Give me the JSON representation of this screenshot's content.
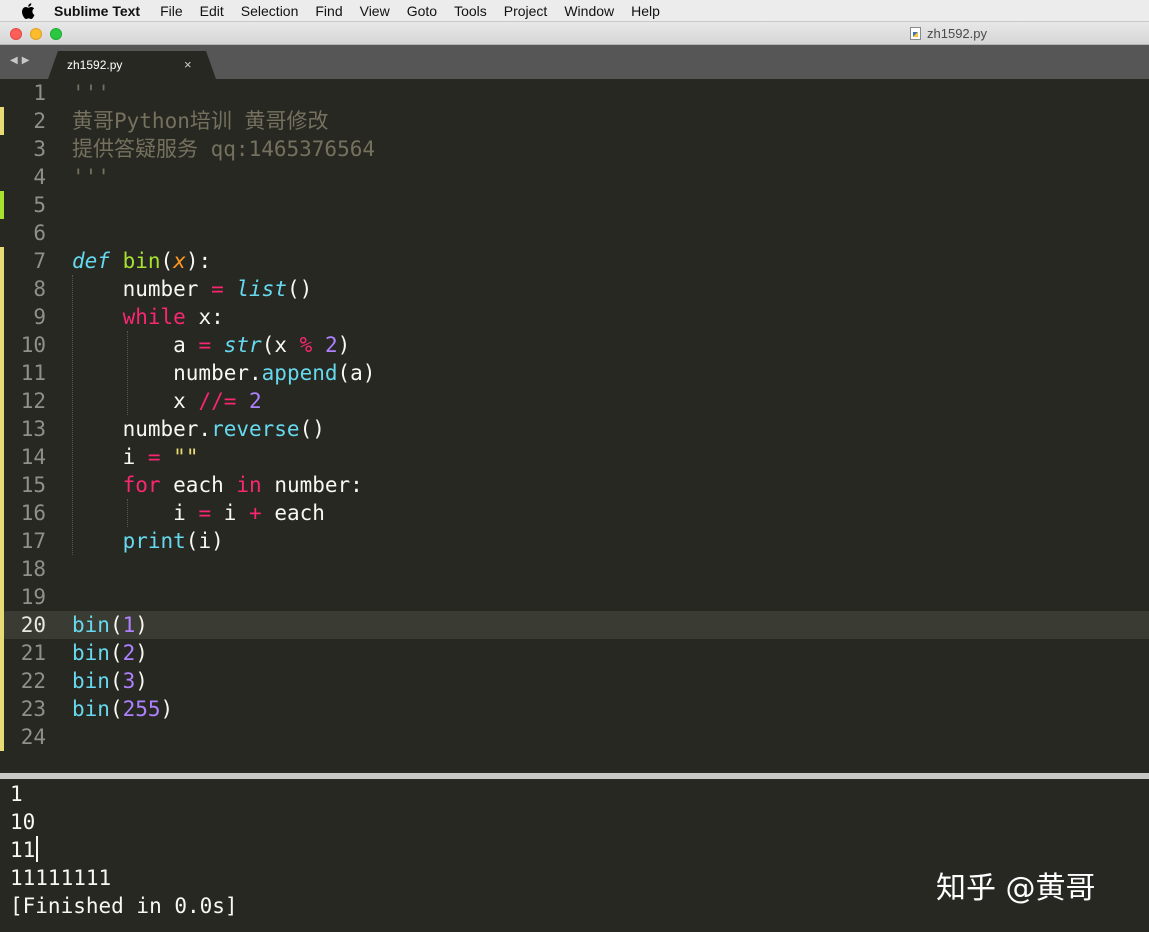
{
  "menubar": {
    "apple_icon": "apple-logo-icon",
    "app_name": "Sublime Text",
    "items": [
      "File",
      "Edit",
      "Selection",
      "Find",
      "View",
      "Goto",
      "Tools",
      "Project",
      "Window",
      "Help"
    ]
  },
  "window": {
    "title": "zh1592.py",
    "title_icon": "python-file-icon"
  },
  "tabs": [
    {
      "label": "zh1592.py",
      "close": "×"
    }
  ],
  "tab_nav": {
    "prev": "◀",
    "next": "▶"
  },
  "editor": {
    "active_line": 20,
    "line_numbers": [
      "1",
      "2",
      "3",
      "4",
      "5",
      "6",
      "7",
      "8",
      "9",
      "10",
      "11",
      "12",
      "13",
      "14",
      "15",
      "16",
      "17",
      "18",
      "19",
      "20",
      "21",
      "22",
      "23",
      "24"
    ],
    "lines": [
      [
        {
          "t": "'''",
          "c": "comment"
        }
      ],
      [
        {
          "t": "黄哥Python培训 黄哥修改",
          "c": "comment"
        }
      ],
      [
        {
          "t": "提供答疑服务 qq:1465376564",
          "c": "comment"
        }
      ],
      [
        {
          "t": "'''",
          "c": "comment"
        }
      ],
      [],
      [],
      [
        {
          "t": "def",
          "c": "def"
        },
        {
          "t": " ",
          "c": ""
        },
        {
          "t": "bin",
          "c": "fn"
        },
        {
          "t": "(",
          "c": ""
        },
        {
          "t": "x",
          "c": "param"
        },
        {
          "t": "):",
          "c": ""
        }
      ],
      [
        {
          "t": "    number ",
          "c": ""
        },
        {
          "t": "=",
          "c": "op"
        },
        {
          "t": " ",
          "c": ""
        },
        {
          "t": "list",
          "c": "builtin-i"
        },
        {
          "t": "()",
          "c": ""
        }
      ],
      [
        {
          "t": "    ",
          "c": ""
        },
        {
          "t": "while",
          "c": "kw"
        },
        {
          "t": " x:",
          "c": ""
        }
      ],
      [
        {
          "t": "        a ",
          "c": ""
        },
        {
          "t": "=",
          "c": "op"
        },
        {
          "t": " ",
          "c": ""
        },
        {
          "t": "str",
          "c": "builtin-i"
        },
        {
          "t": "(x ",
          "c": ""
        },
        {
          "t": "%",
          "c": "op"
        },
        {
          "t": " ",
          "c": ""
        },
        {
          "t": "2",
          "c": "num"
        },
        {
          "t": ")",
          "c": ""
        }
      ],
      [
        {
          "t": "        number.",
          "c": ""
        },
        {
          "t": "append",
          "c": "builtin"
        },
        {
          "t": "(a)",
          "c": ""
        }
      ],
      [
        {
          "t": "        x ",
          "c": ""
        },
        {
          "t": "//=",
          "c": "op"
        },
        {
          "t": " ",
          "c": ""
        },
        {
          "t": "2",
          "c": "num"
        }
      ],
      [
        {
          "t": "    number.",
          "c": ""
        },
        {
          "t": "reverse",
          "c": "builtin"
        },
        {
          "t": "()",
          "c": ""
        }
      ],
      [
        {
          "t": "    i ",
          "c": ""
        },
        {
          "t": "=",
          "c": "op"
        },
        {
          "t": " ",
          "c": ""
        },
        {
          "t": "\"\"",
          "c": "str"
        }
      ],
      [
        {
          "t": "    ",
          "c": ""
        },
        {
          "t": "for",
          "c": "kw"
        },
        {
          "t": " each ",
          "c": ""
        },
        {
          "t": "in",
          "c": "kw"
        },
        {
          "t": " number:",
          "c": ""
        }
      ],
      [
        {
          "t": "        i ",
          "c": ""
        },
        {
          "t": "=",
          "c": "op"
        },
        {
          "t": " i ",
          "c": ""
        },
        {
          "t": "+",
          "c": "op"
        },
        {
          "t": " each",
          "c": ""
        }
      ],
      [
        {
          "t": "    ",
          "c": ""
        },
        {
          "t": "print",
          "c": "builtin"
        },
        {
          "t": "(i)",
          "c": ""
        }
      ],
      [],
      [],
      [
        {
          "t": "bin",
          "c": "builtin"
        },
        {
          "t": "(",
          "c": ""
        },
        {
          "t": "1",
          "c": "num"
        },
        {
          "t": ")",
          "c": ""
        }
      ],
      [
        {
          "t": "bin",
          "c": "builtin"
        },
        {
          "t": "(",
          "c": ""
        },
        {
          "t": "2",
          "c": "num"
        },
        {
          "t": ")",
          "c": ""
        }
      ],
      [
        {
          "t": "bin",
          "c": "builtin"
        },
        {
          "t": "(",
          "c": ""
        },
        {
          "t": "3",
          "c": "num"
        },
        {
          "t": ")",
          "c": ""
        }
      ],
      [
        {
          "t": "bin",
          "c": "builtin"
        },
        {
          "t": "(",
          "c": ""
        },
        {
          "t": "255",
          "c": "num"
        },
        {
          "t": ")",
          "c": ""
        }
      ],
      []
    ]
  },
  "output": {
    "lines": [
      "1",
      "10",
      "11",
      "11111111",
      "[Finished in 0.0s]"
    ],
    "cursor_after_line": 3
  },
  "watermark": "知乎 @黄哥",
  "colors": {
    "background": "#272822",
    "modified_gutter": "#e6db74",
    "added_gutter": "#a6e22e"
  }
}
